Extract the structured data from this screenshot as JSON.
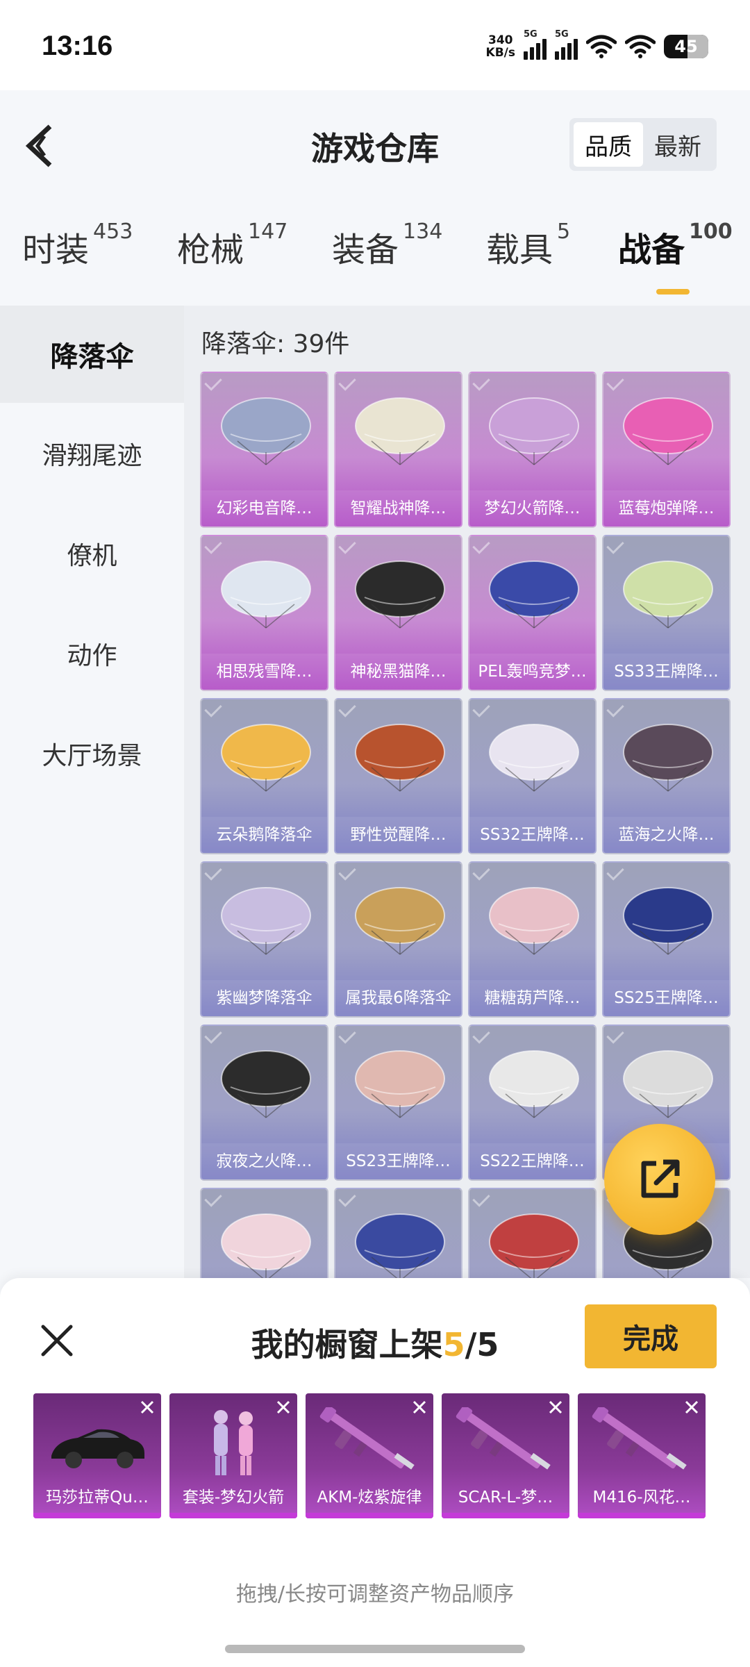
{
  "status": {
    "time": "13:16",
    "net_speed_value": "340",
    "net_speed_unit": "KB/s",
    "sim1": "5G",
    "sim2": "5G",
    "battery": "45"
  },
  "header": {
    "title": "游戏仓库",
    "sort_options": [
      "品质",
      "最新"
    ],
    "sort_selected": "品质"
  },
  "tabs": [
    {
      "label": "时装",
      "count": "453"
    },
    {
      "label": "枪械",
      "count": "147"
    },
    {
      "label": "装备",
      "count": "134"
    },
    {
      "label": "载具",
      "count": "5"
    },
    {
      "label": "战备",
      "count": "100"
    }
  ],
  "active_tab": "战备",
  "sidebar": {
    "items": [
      "降落伞",
      "滑翔尾迹",
      "僚机",
      "动作",
      "大厅场景"
    ],
    "active": "降落伞"
  },
  "content": {
    "count_label": "降落伞: 39件",
    "items": [
      {
        "name": "幻彩电音降…",
        "rarity": "purple",
        "color": "#9aa6c8"
      },
      {
        "name": "智耀战神降…",
        "rarity": "purple",
        "color": "#e9e4d2"
      },
      {
        "name": "梦幻火箭降…",
        "rarity": "purple",
        "color": "#c9a0d8"
      },
      {
        "name": "蓝莓炮弹降…",
        "rarity": "purple",
        "color": "#e85fb4"
      },
      {
        "name": "相思残雪降…",
        "rarity": "purple",
        "color": "#dfe6f0"
      },
      {
        "name": "神秘黑猫降…",
        "rarity": "purple",
        "color": "#2b2b2b"
      },
      {
        "name": "PEL轰鸣竞梦…",
        "rarity": "purple",
        "color": "#3a4aa8"
      },
      {
        "name": "SS33王牌降…",
        "rarity": "blue",
        "color": "#cfe0a8"
      },
      {
        "name": "云朵鹅降落伞",
        "rarity": "blue",
        "color": "#f0b84a"
      },
      {
        "name": "野性觉醒降…",
        "rarity": "blue",
        "color": "#b8532e"
      },
      {
        "name": "SS32王牌降…",
        "rarity": "blue",
        "color": "#e8e4f0"
      },
      {
        "name": "蓝海之火降…",
        "rarity": "blue",
        "color": "#5a4a5a"
      },
      {
        "name": "紫幽梦降落伞",
        "rarity": "blue",
        "color": "#c8bde0"
      },
      {
        "name": "属我最6降落伞",
        "rarity": "blue",
        "color": "#c9a05a"
      },
      {
        "name": "糖糖葫芦降…",
        "rarity": "blue",
        "color": "#e8c0c8"
      },
      {
        "name": "SS25王牌降…",
        "rarity": "blue",
        "color": "#2a3a8a"
      },
      {
        "name": "寂夜之火降…",
        "rarity": "blue",
        "color": "#2c2c2c"
      },
      {
        "name": "SS23王牌降…",
        "rarity": "blue",
        "color": "#e0b8b0"
      },
      {
        "name": "SS22王牌降…",
        "rarity": "blue",
        "color": "#e8e8e8"
      },
      {
        "name": "",
        "rarity": "blue",
        "color": "#dcdcdc"
      },
      {
        "name": "",
        "rarity": "blue",
        "color": "#f0d4dc"
      },
      {
        "name": "",
        "rarity": "blue",
        "color": "#3a4aa0"
      },
      {
        "name": "",
        "rarity": "blue",
        "color": "#c04040"
      },
      {
        "name": "",
        "rarity": "blue",
        "color": "#2e2e2e"
      }
    ]
  },
  "sheet": {
    "title_prefix": "我的橱窗上架",
    "current": "5",
    "total": "/5",
    "done_label": "完成",
    "hint": "拖拽/长按可调整资产物品顺序",
    "items": [
      {
        "name": "玛莎拉蒂Qu…",
        "icon": "car"
      },
      {
        "name": "套装-梦幻火箭",
        "icon": "outfit"
      },
      {
        "name": "AKM-炫紫旋律",
        "icon": "rifle"
      },
      {
        "name": "SCAR-L-梦…",
        "icon": "rifle"
      },
      {
        "name": "M416-风花…",
        "icon": "rifle"
      }
    ]
  },
  "colors": {
    "accent": "#f2b632",
    "purple_rarity": "#b24fc6",
    "blue_rarity": "#7d7fc4"
  }
}
